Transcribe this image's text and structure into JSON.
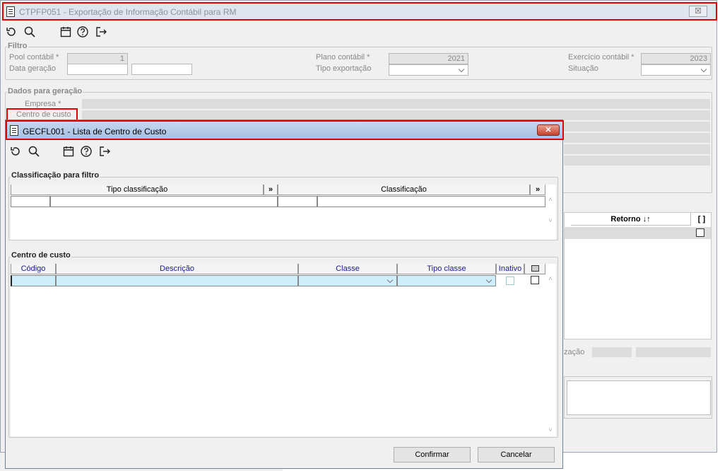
{
  "main": {
    "title": "CTPFP051 - Exportação de Informação Contábil para RM",
    "close": "☒",
    "filtro": {
      "legend": "Filtro",
      "pool_label": "Pool contábil *",
      "pool_value": "1",
      "plano_label": "Plano contábil *",
      "plano_value": "2021",
      "exercicio_label": "Exercício contábil *",
      "exercicio_value": "2023",
      "data_label": "Data geração",
      "tipo_label": "Tipo exportação",
      "situacao_label": "Situação"
    },
    "dados": {
      "legend": "Dados para geração",
      "empresa_label": "Empresa *",
      "centro_label": "Centro de custo"
    },
    "right_grid": {
      "retorno": "Retorno ↓↑",
      "bracket": "[ ]"
    },
    "zacao": "zação"
  },
  "dialog": {
    "title": "GECFL001 - Lista de Centro de Custo",
    "close": "✕",
    "classificacao": {
      "legend": "Classificação para filtro",
      "col_tipo": "Tipo classificação",
      "col_class": "Classificação",
      "more": "»"
    },
    "centro": {
      "legend": "Centro de custo",
      "col_codigo": "Código",
      "col_descricao": "Descrição",
      "col_classe": "Classe",
      "col_tipo_classe": "Tipo classe",
      "col_inativo": "Inativo"
    },
    "confirm": "Confirmar",
    "cancel": "Cancelar"
  }
}
